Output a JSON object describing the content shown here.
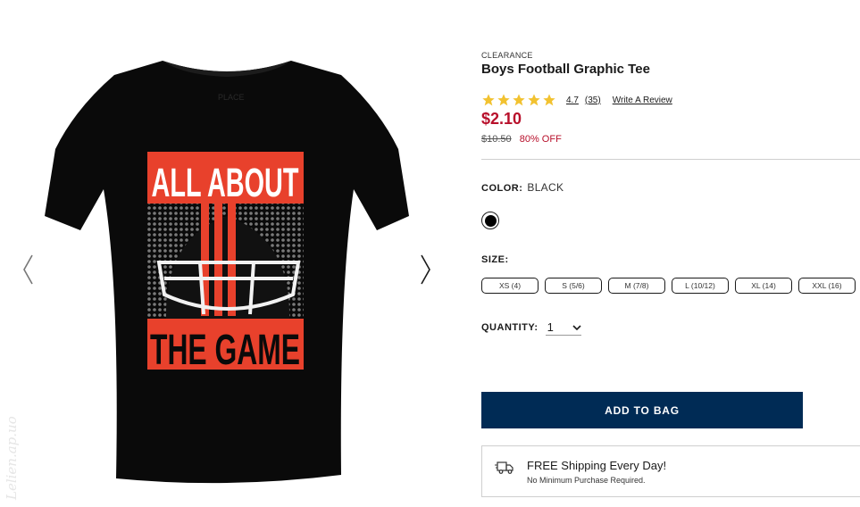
{
  "product": {
    "badge": "CLEARANCE",
    "title": "Boys Football Graphic Tee",
    "rating": {
      "stars": 5,
      "value": "4.7",
      "count": "(35)",
      "write_review": "Write A Review"
    },
    "price": "$2.10",
    "original_price": "$10.50",
    "discount": "80% OFF"
  },
  "image": {
    "tee_color": "#0a0a0a",
    "graphic_red": "#e8412c",
    "top_text": "ALL ABOUT",
    "bottom_text": "THE GAME",
    "tag_text": "PLACE"
  },
  "watermark": "Lelien.ap.uo",
  "color": {
    "label": "COLOR:",
    "value": "BLACK",
    "swatch": "#000000"
  },
  "size": {
    "label": "SIZE:",
    "options": [
      "XS (4)",
      "S (5/6)",
      "M (7/8)",
      "L (10/12)",
      "XL (14)",
      "XXL (16)"
    ]
  },
  "quantity": {
    "label": "QUANTITY:",
    "value": "1"
  },
  "add_to_bag": "ADD TO BAG",
  "shipping": {
    "title": "FREE Shipping Every Day!",
    "subtitle": "No Minimum Purchase Required."
  },
  "colors": {
    "accent": "#b8102b",
    "button": "#002b55",
    "star": "#f2c230"
  }
}
